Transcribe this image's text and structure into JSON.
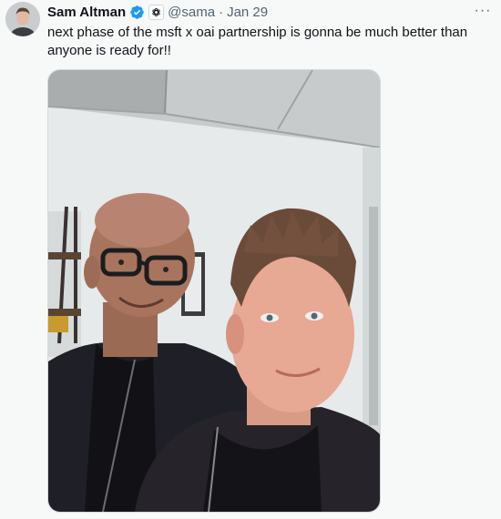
{
  "tweet": {
    "author_name": "Sam Altman",
    "verified_icon": "verified-badge-icon",
    "affiliation_icon": "openai-logo-icon",
    "handle": "@sama",
    "separator": "·",
    "date": "Jan 29",
    "more_label": "···",
    "text": "next phase of the msft x oai partnership is gonna be much better than anyone is ready for!!",
    "media": {
      "type": "photo",
      "subject": "selfie-two-people-office"
    }
  },
  "colors": {
    "background": "#f7f9f9",
    "text_primary": "#0f1419",
    "text_secondary": "#536471",
    "verified_blue": "#1d9bf0"
  }
}
